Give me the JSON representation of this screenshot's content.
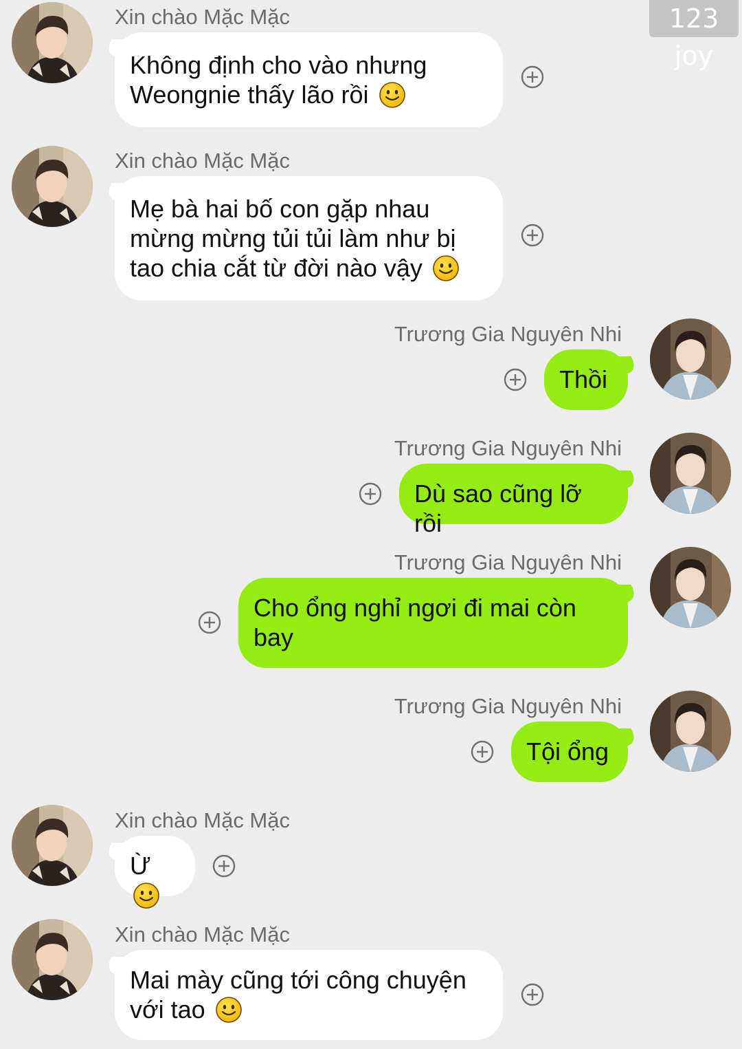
{
  "watermark": "123 joy",
  "contacts": {
    "left_name": "Xin chào Mặc Mặc",
    "right_name": "Trương Gia Nguyên Nhi"
  },
  "messages": [
    {
      "side": "left",
      "sender": "Xin chào Mặc Mặc",
      "lines": [
        "Không định cho vào nhưng",
        "Weongnie thấy lão rồi"
      ],
      "emoji": "smile"
    },
    {
      "side": "left",
      "sender": "Xin chào Mặc Mặc",
      "lines": [
        "Mẹ bà hai bố con gặp nhau",
        "mừng mừng tủi tủi làm như bị",
        "tao chia cắt từ đời nào vậy"
      ],
      "emoji": "smile"
    },
    {
      "side": "right",
      "sender": "Trương Gia Nguyên Nhi",
      "lines": [
        "Thồi"
      ],
      "emoji": ""
    },
    {
      "side": "right",
      "sender": "Trương Gia Nguyên Nhi",
      "lines": [
        "Dù sao cũng lỡ rồi"
      ],
      "emoji": ""
    },
    {
      "side": "right",
      "sender": "Trương Gia Nguyên Nhi",
      "lines": [
        "Cho ổng nghỉ ngơi đi mai còn",
        "bay"
      ],
      "emoji": ""
    },
    {
      "side": "right",
      "sender": "Trương Gia Nguyên Nhi",
      "lines": [
        "Tội ổng"
      ],
      "emoji": ""
    },
    {
      "side": "left",
      "sender": "Xin chào Mặc Mặc",
      "lines": [
        "Ừ"
      ],
      "emoji": "smile"
    },
    {
      "side": "left",
      "sender": "Xin chào Mặc Mặc",
      "lines": [
        "Mai mày cũng tới công chuyện",
        "với tao"
      ],
      "emoji": "smile"
    }
  ],
  "colors": {
    "background": "#ededed",
    "incoming_bubble": "#ffffff",
    "outgoing_bubble": "#95ec14",
    "name_text": "#6b6b6b"
  },
  "icons": {
    "add": "plus-circle-icon",
    "emoji": "smiley-emoji-icon"
  }
}
